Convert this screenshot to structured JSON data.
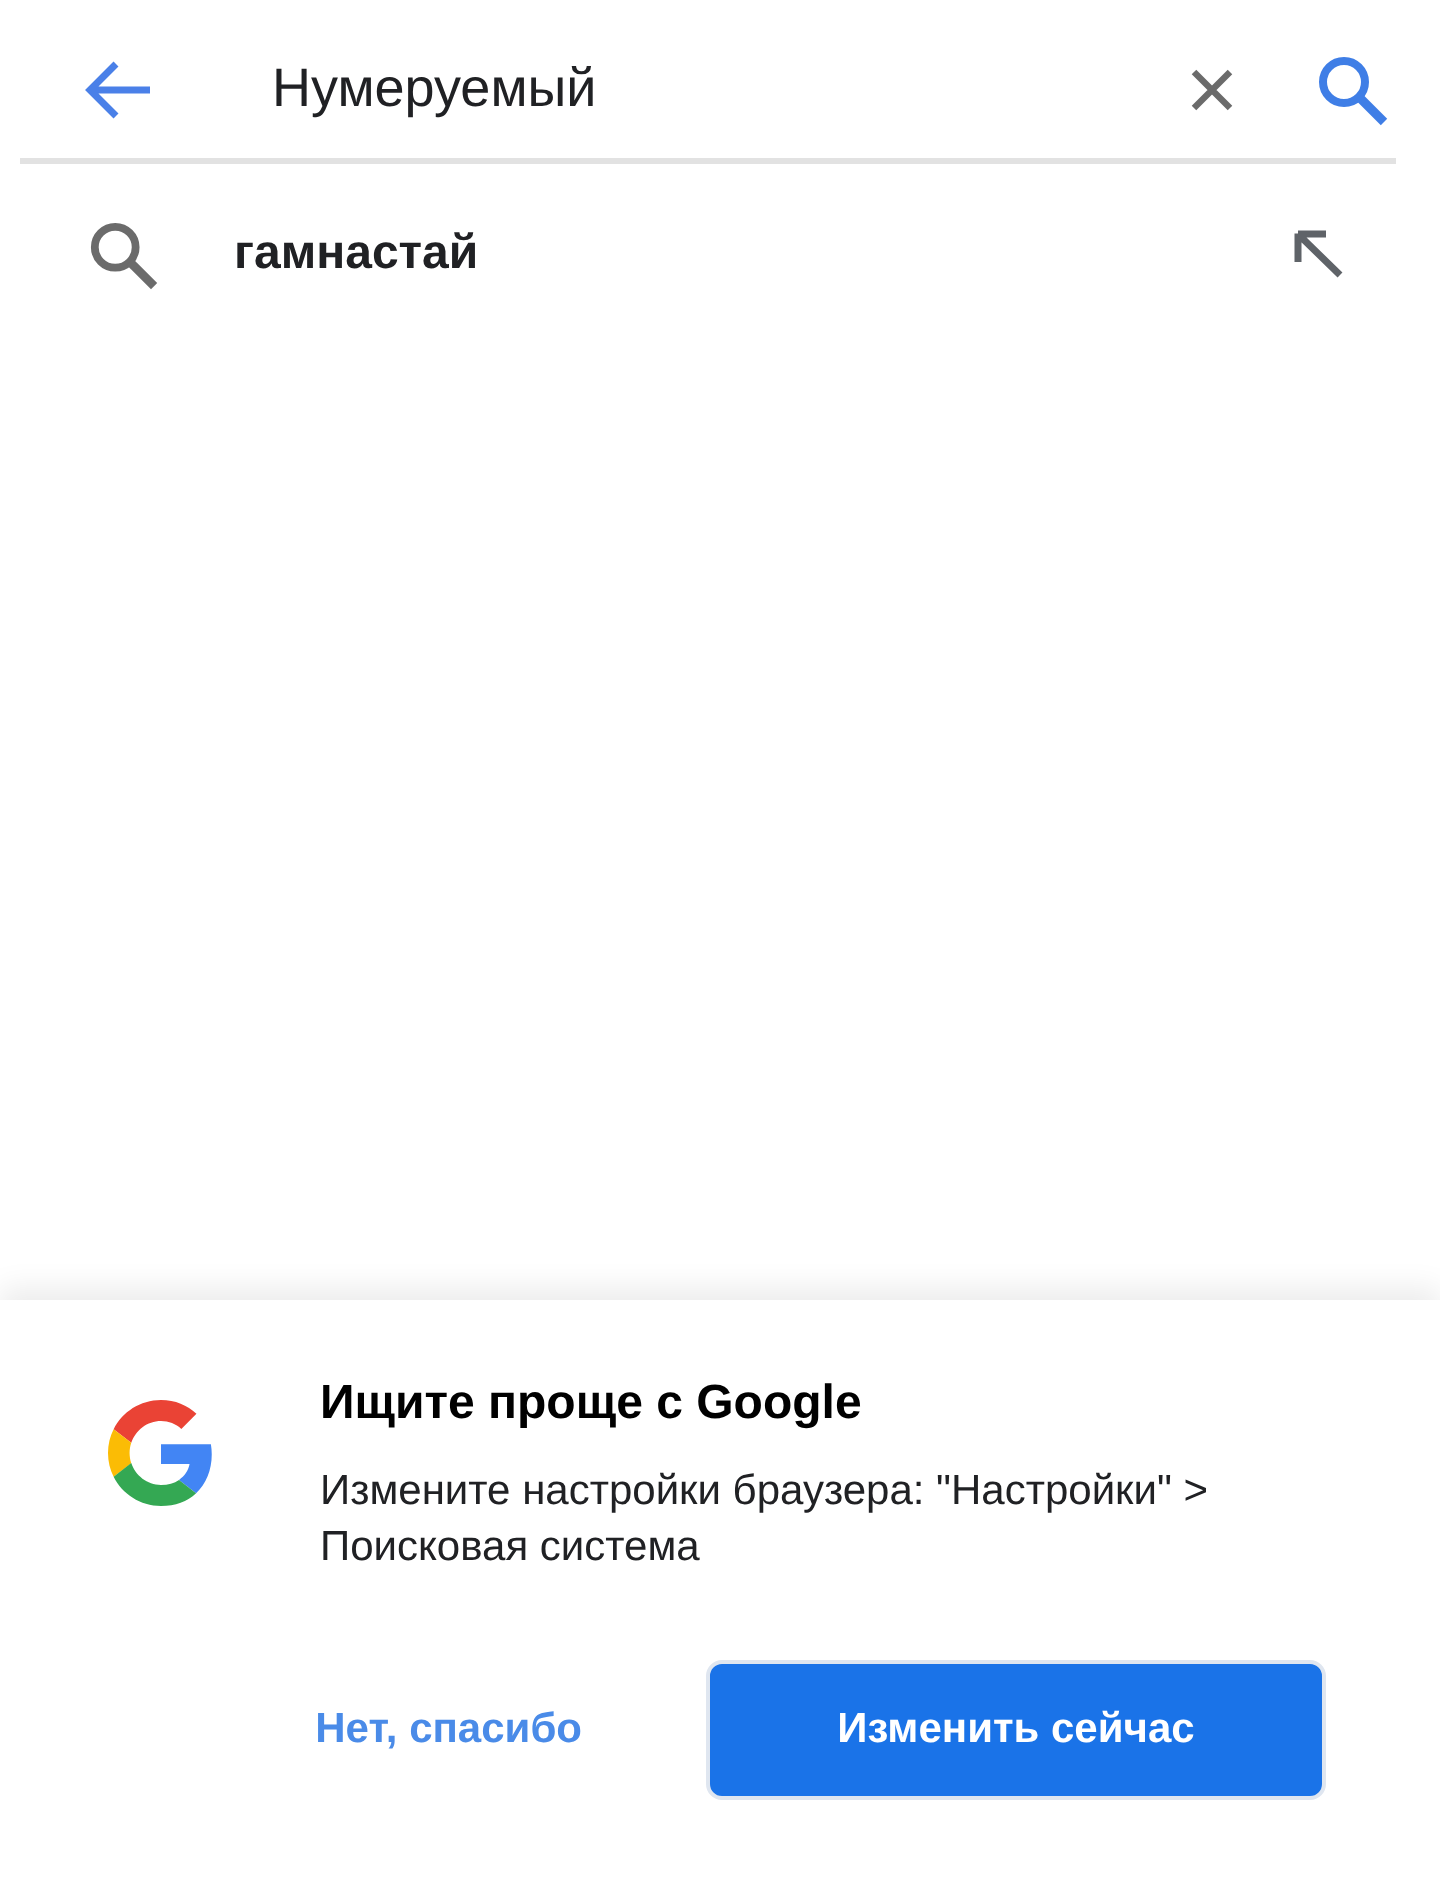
{
  "search_bar": {
    "query": "Нумеруемый"
  },
  "suggestions": [
    {
      "text": "гамнастай"
    }
  ],
  "prompt": {
    "title": "Ищите проще с Google",
    "body": "Измените настройки браузера: \"Настройки\" > Поисковая система",
    "buttons": [
      {
        "label": "Нет, спасибо",
        "kind": "text"
      },
      {
        "label": "Изменить сейчас",
        "kind": "primary"
      }
    ]
  }
}
